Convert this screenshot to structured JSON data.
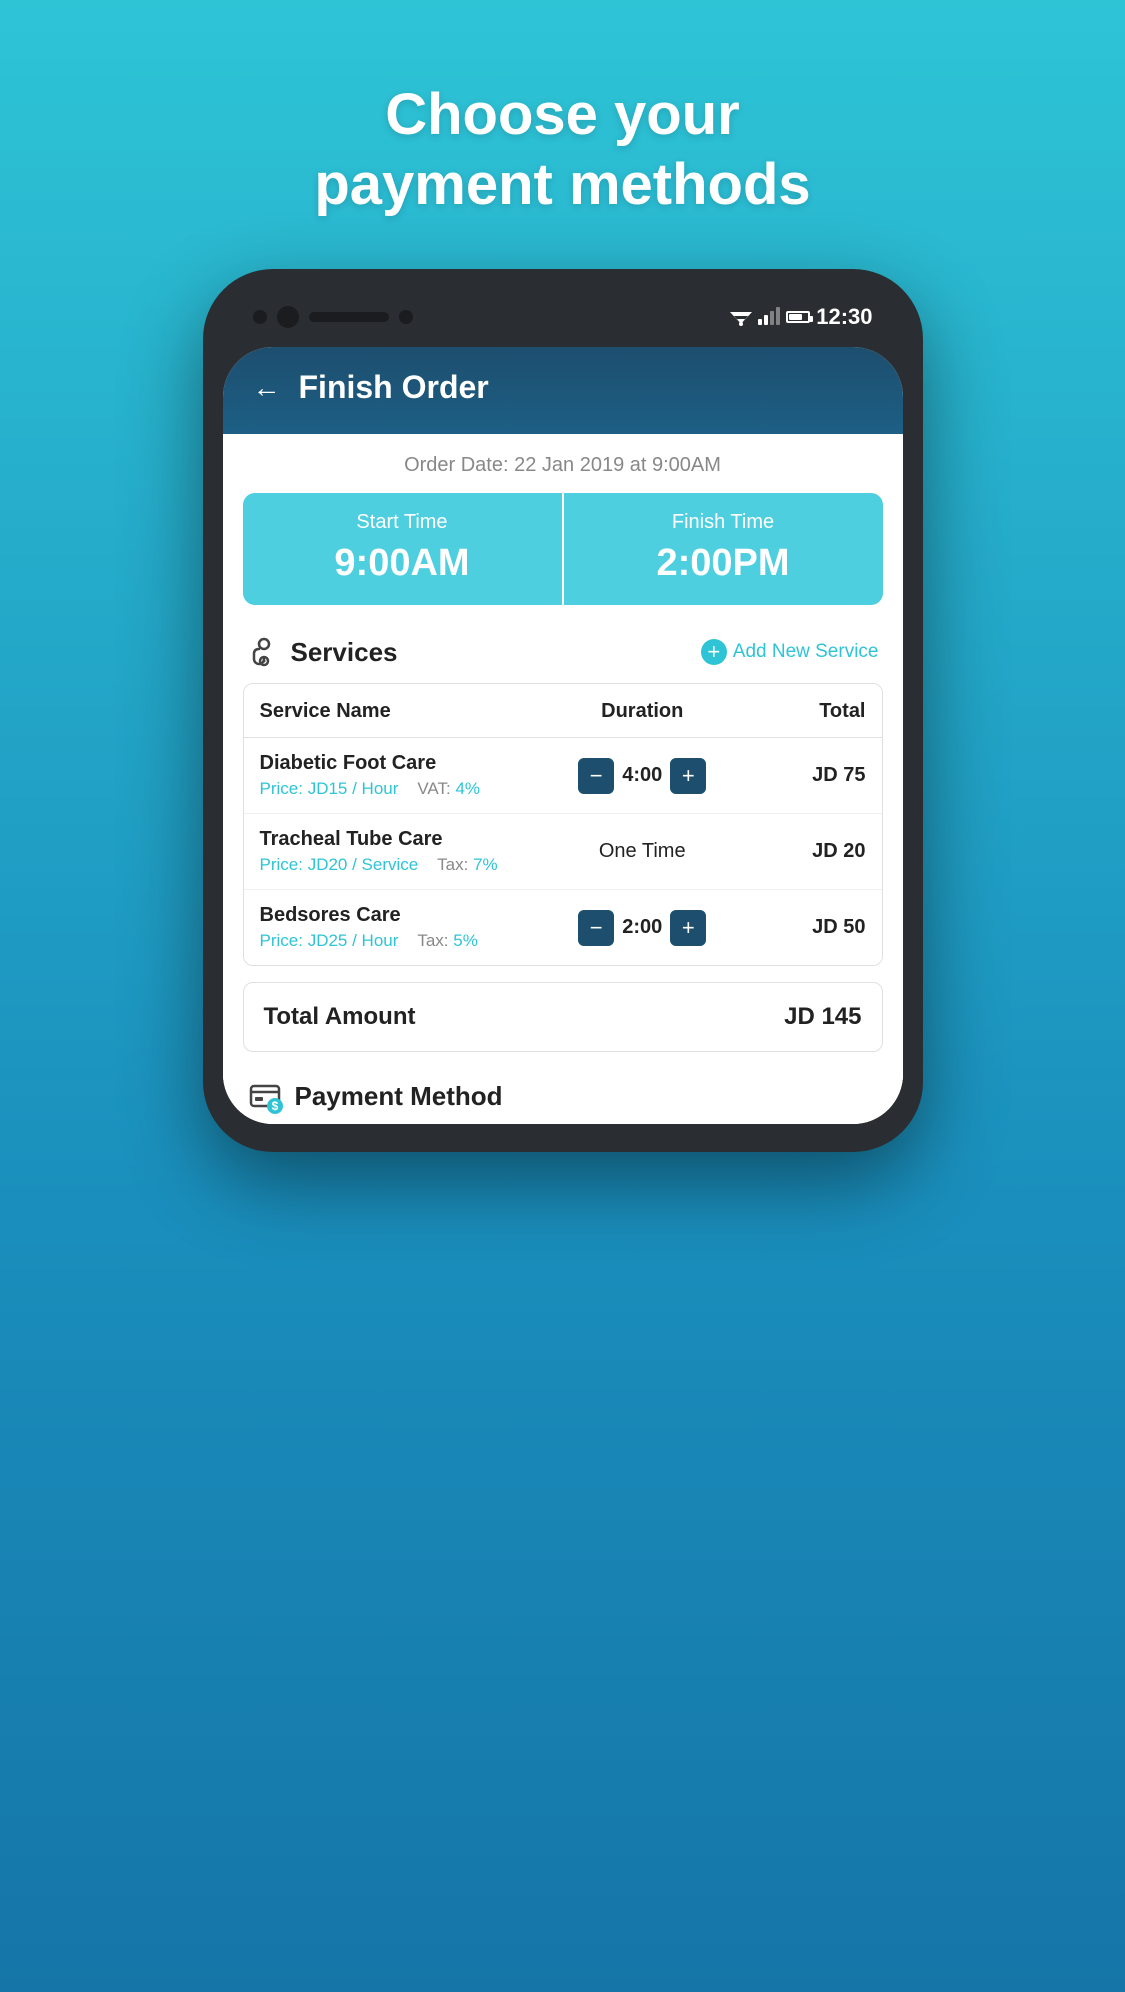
{
  "hero": {
    "title_line1": "Choose your",
    "title_line2": "payment methods"
  },
  "status_bar": {
    "time": "12:30"
  },
  "app": {
    "back_label": "←",
    "title": "Finish Order",
    "order_date": "Order Date: 22 Jan 2019 at 9:00AM",
    "start_time_label": "Start Time",
    "start_time_value": "9:00AM",
    "finish_time_label": "Finish Time",
    "finish_time_value": "2:00PM",
    "services_title": "Services",
    "add_service_label": "Add New Service",
    "table_header": {
      "name": "Service Name",
      "duration": "Duration",
      "total": "Total"
    },
    "services": [
      {
        "name": "Diabetic Foot Care",
        "price_label": "Price:",
        "price": "JD15 / Hour",
        "vat_label": "VAT:",
        "vat": "4%",
        "duration": "4:00",
        "total": "JD 75",
        "type": "stepper"
      },
      {
        "name": "Tracheal Tube Care",
        "price_label": "Price:",
        "price": "JD20 / Service",
        "vat_label": "Tax:",
        "vat": "7%",
        "duration": "One Time",
        "total": "JD 20",
        "type": "text"
      },
      {
        "name": "Bedsores Care",
        "price_label": "Price:",
        "price": "JD25 / Hour",
        "vat_label": "Tax:",
        "vat": "5%",
        "duration": "2:00",
        "total": "JD 50",
        "type": "stepper"
      }
    ],
    "total_amount_label": "Total Amount",
    "total_amount_value": "JD 145",
    "payment_method_label": "Payment Method"
  }
}
